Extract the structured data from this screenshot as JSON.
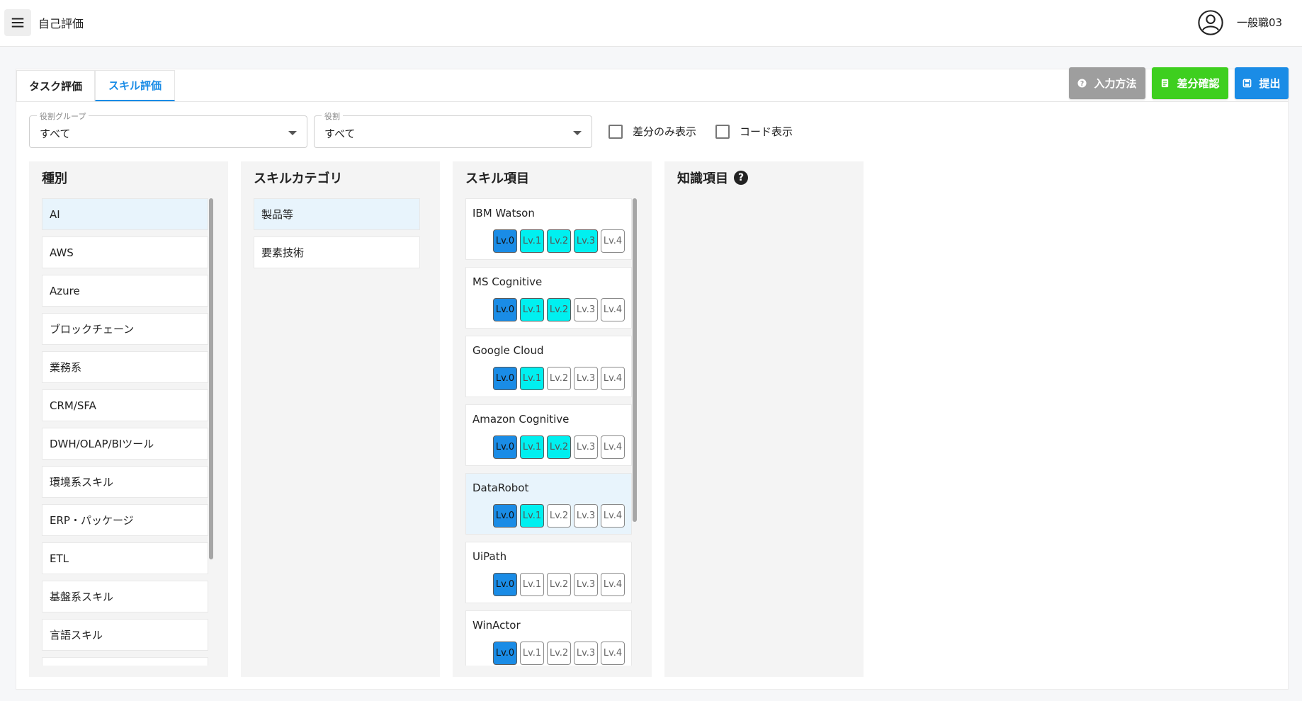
{
  "header": {
    "title": "自己評価",
    "user": "一般職03",
    "menu_icon": "hamburger-icon",
    "user_icon": "account-circle-icon"
  },
  "tabs": [
    {
      "label": "タスク評価",
      "active": false
    },
    {
      "label": "スキル評価",
      "active": true
    }
  ],
  "actions": {
    "help": "入力方法",
    "diff": "差分確認",
    "submit": "提出"
  },
  "colors": {
    "accent": "#1a8ce6",
    "green": "#3ecf1f",
    "grey": "#9e9e9e",
    "level_done": "#00f0f0",
    "level_base": "#1a8ce6"
  },
  "filters": {
    "role_group": {
      "label": "役割グループ",
      "value": "すべて"
    },
    "role": {
      "label": "役割",
      "value": "すべて"
    },
    "diff_only": {
      "label": "差分のみ表示",
      "checked": false
    },
    "show_code": {
      "label": "コード表示",
      "checked": false
    }
  },
  "columns": {
    "type": {
      "title": "種別",
      "items": [
        "AI",
        "AWS",
        "Azure",
        "ブロックチェーン",
        "業務系",
        "CRM/SFA",
        "DWH/OLAP/BIツール",
        "環境系スキル",
        "ERP・パッケージ",
        "ETL",
        "基盤系スキル",
        "言語スキル",
        ""
      ],
      "selected": 0
    },
    "category": {
      "title": "スキルカテゴリ",
      "items": [
        "製品等",
        "要素技術"
      ],
      "selected": 0
    },
    "skills": {
      "title": "スキル項目",
      "items": [
        {
          "name": "IBM Watson",
          "level": 3
        },
        {
          "name": "MS Cognitive",
          "level": 2
        },
        {
          "name": "Google Cloud",
          "level": 1
        },
        {
          "name": "Amazon Cognitive",
          "level": 2
        },
        {
          "name": "DataRobot",
          "level": 1
        },
        {
          "name": "UiPath",
          "level": 0
        },
        {
          "name": "WinActor",
          "level": 0
        }
      ],
      "selected": 4,
      "level_labels": [
        "Lv.0",
        "Lv.1",
        "Lv.2",
        "Lv.3",
        "Lv.4"
      ]
    },
    "knowledge": {
      "title": "知識項目",
      "help_icon": "question-circle-icon"
    }
  }
}
